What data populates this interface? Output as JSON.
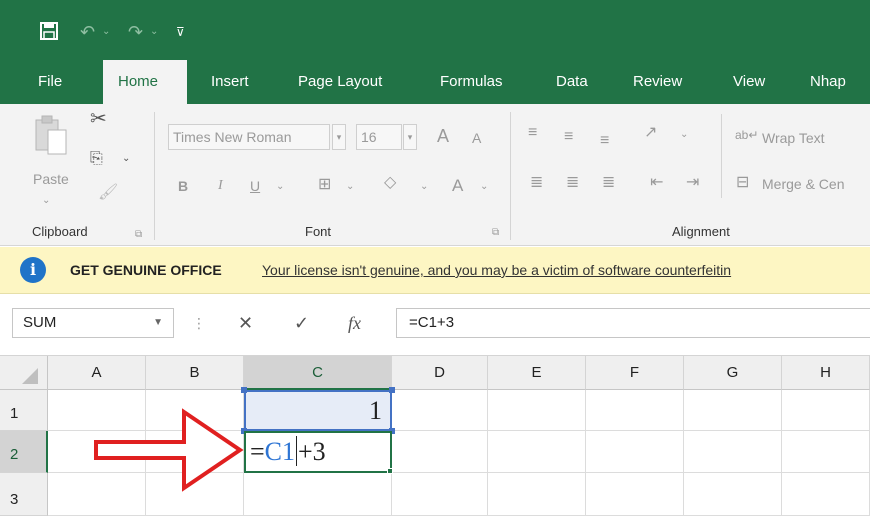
{
  "quick_access": {
    "save_icon": "save-icon",
    "undo_icon": "undo-icon",
    "redo_icon": "redo-icon",
    "customize_icon": "customize-qat-icon"
  },
  "tabs": [
    "File",
    "Home",
    "Insert",
    "Page Layout",
    "Formulas",
    "Data",
    "Review",
    "View",
    "Nhap"
  ],
  "active_tab": "Home",
  "ribbon": {
    "clipboard": {
      "paste_label": "Paste",
      "group_label": "Clipboard"
    },
    "font": {
      "font_name": "Times New Roman",
      "font_size": "16",
      "group_label": "Font",
      "bold": "B",
      "italic": "I",
      "underline": "U",
      "font_color_glyph": "A",
      "grow_glyph": "A",
      "shrink_glyph": "A"
    },
    "alignment": {
      "wrap_text": "Wrap Text",
      "merge_center": "Merge & Cen",
      "group_label": "Alignment"
    }
  },
  "message_bar": {
    "title": "GET GENUINE OFFICE",
    "message": "Your license isn't genuine, and you may be a victim of software counterfeitin"
  },
  "formula_bar": {
    "name_box": "SUM",
    "formula": "=C1+3",
    "cancel_glyph": "✕",
    "enter_glyph": "✓",
    "fx_glyph": "fx"
  },
  "grid": {
    "columns": [
      "A",
      "B",
      "C",
      "D",
      "E",
      "F",
      "G",
      "H"
    ],
    "selected_column": "C",
    "rows": [
      "1",
      "2",
      "3"
    ],
    "selected_row": "2",
    "cells": {
      "C1": "1",
      "C2_prefix": "=",
      "C2_ref": "C1",
      "C2_suffix": "+3"
    }
  },
  "colors": {
    "excel_green": "#217346",
    "reference_blue": "#4472c4",
    "message_bar": "#fdf6c3",
    "arrow_red": "#e02020"
  }
}
